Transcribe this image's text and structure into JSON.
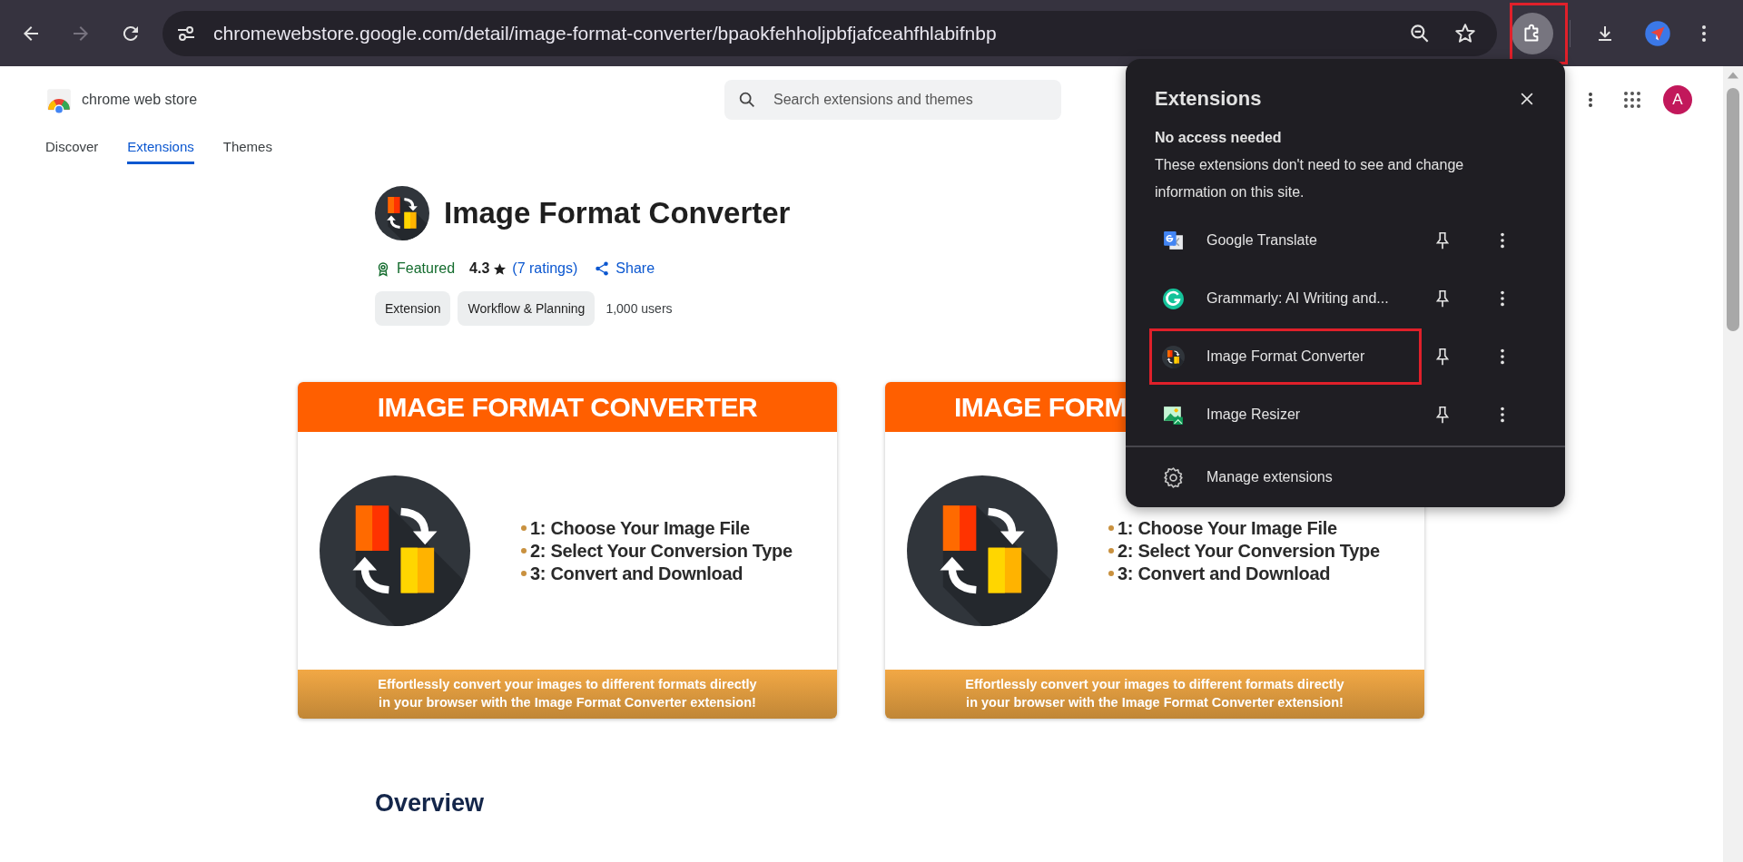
{
  "browser": {
    "url": "chromewebstore.google.com/detail/image-format-converter/bpaokfehholjpbfjafceahfhlabifnbp",
    "extensions_button": {
      "highlighted": true
    }
  },
  "store": {
    "logo_text": "chrome web store",
    "search": {
      "placeholder": "Search extensions and themes"
    },
    "avatar": "A",
    "tabs": [
      {
        "label": "Discover",
        "selected": false
      },
      {
        "label": "Extensions",
        "selected": true
      },
      {
        "label": "Themes",
        "selected": false
      }
    ]
  },
  "extension": {
    "title": "Image Format Converter",
    "featured": "Featured",
    "rating": "4.3",
    "ratings": "(7 ratings)",
    "share": "Share",
    "chips": [
      "Extension",
      "Workflow & Planning"
    ],
    "users": "1,000 users"
  },
  "screenshots": [
    {
      "title": "IMAGE FORMAT CONVERTER",
      "steps": [
        "1: Choose Your Image File",
        "2: Select Your Conversion Type",
        "3: Convert and Download"
      ],
      "caption": "Effortlessly convert your images to different formats directly\nin your browser with the Image Format Converter extension!"
    },
    {
      "title": "IMAGE FORM",
      "steps": [
        "1: Choose Your Image File",
        "2: Select Your Conversion Type",
        "3: Convert and Download"
      ],
      "caption": "Effortlessly convert your images to different formats directly\nin your browser with the Image Format Converter extension!"
    }
  ],
  "overview": "Overview",
  "panel": {
    "title": "Extensions",
    "section": "No access needed",
    "description": "These extensions don't need to see and change information on this site.",
    "items": [
      {
        "name": "Google Translate",
        "kind": "translate",
        "highlighted": false
      },
      {
        "name": "Grammarly: AI Writing and...",
        "kind": "grammarly",
        "highlighted": false
      },
      {
        "name": "Image Format Converter",
        "kind": "converter",
        "highlighted": true
      },
      {
        "name": "Image Resizer",
        "kind": "resizer",
        "highlighted": false
      }
    ],
    "manage": "Manage extensions"
  }
}
